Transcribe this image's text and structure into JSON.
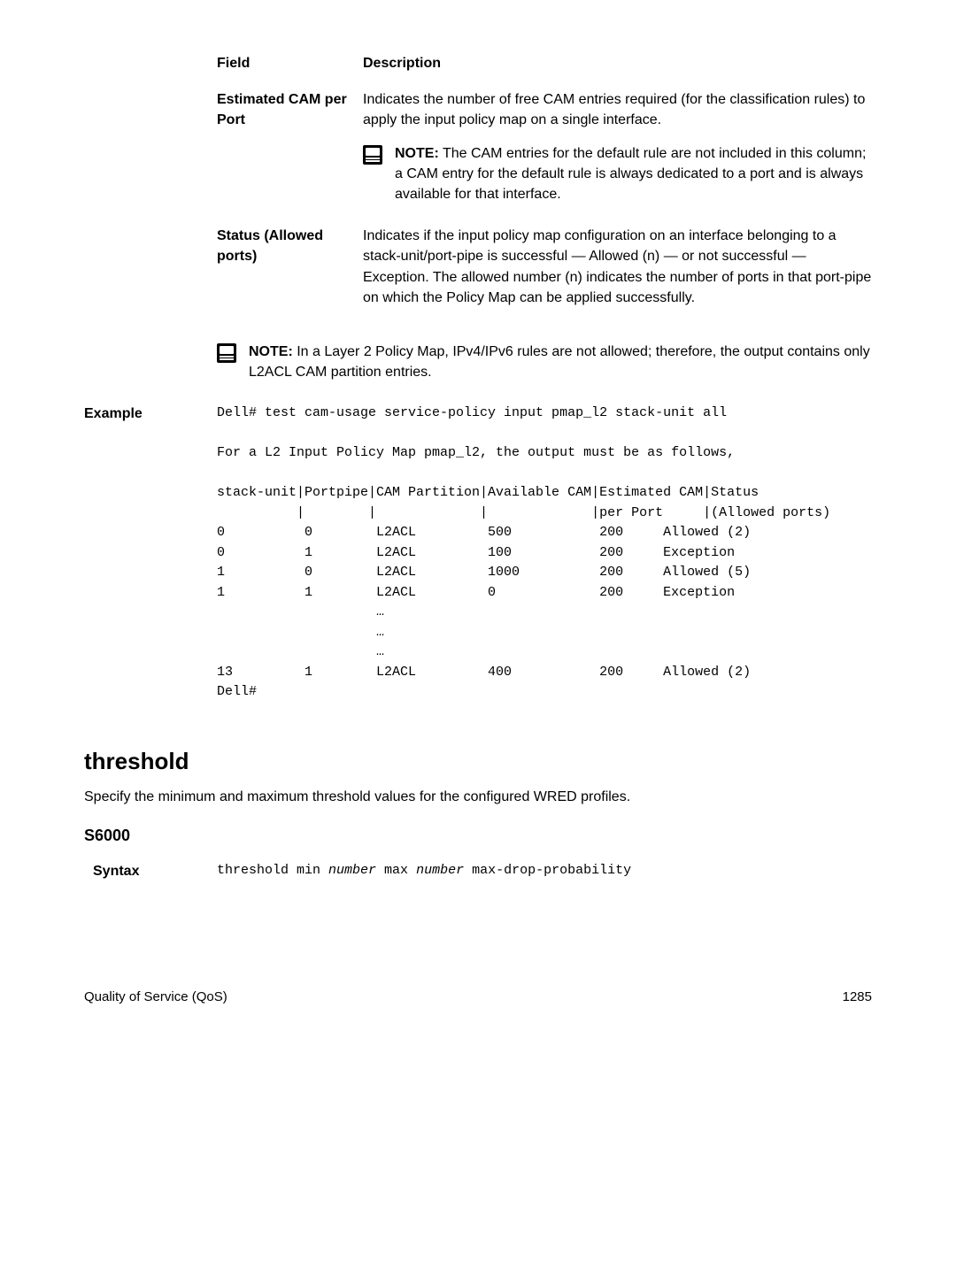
{
  "fields": {
    "header_field": "Field",
    "header_desc": "Description",
    "estimated_cam": {
      "label": "Estimated CAM per Port",
      "desc": "Indicates the number of free CAM entries required (for the classification rules) to apply the input policy map on a single interface.",
      "note_prefix": "NOTE:",
      "note_body": " The CAM entries for the default rule are not included in this column; a CAM entry for the default rule is always dedicated to a port and is always available for that interface."
    },
    "status_allowed": {
      "label": "Status (Allowed ports)",
      "desc": "Indicates if the input policy map configuration on an interface belonging to a stack-unit/port-pipe is successful — Allowed (n) — or not successful — Exception. The allowed number (n) indicates the number of ports in that port-pipe on which the Policy Map can be applied successfully."
    }
  },
  "standalone_note": {
    "prefix": "NOTE:",
    "body": " In a Layer 2 Policy Map, IPv4/IPv6 rules are not allowed; therefore, the output contains only L2ACL CAM partition entries."
  },
  "example": {
    "label": "Example",
    "code": "Dell# test cam-usage service-policy input pmap_l2 stack-unit all\n\nFor a L2 Input Policy Map pmap_l2, the output must be as follows,\n\nstack-unit|Portpipe|CAM Partition|Available CAM|Estimated CAM|Status\n          |        |             |             |per Port     |(Allowed ports)\n0          0        L2ACL         500           200     Allowed (2)\n0          1        L2ACL         100           200     Exception\n1          0        L2ACL         1000          200     Allowed (5)\n1          1        L2ACL         0             200     Exception\n                    …\n                    …\n                    …\n13         1        L2ACL         400           200     Allowed (2)\nDell#"
  },
  "threshold": {
    "heading": "threshold",
    "desc": "Specify the minimum and maximum threshold values for the configured WRED profiles.",
    "subhead": "S6000",
    "syntax_label": "Syntax",
    "syntax_pre": "threshold min ",
    "syntax_num1": "number",
    "syntax_mid": " max ",
    "syntax_num2": "number",
    "syntax_post": " max-drop-probability"
  },
  "footer": {
    "left": "Quality of Service (QoS)",
    "right": "1285"
  }
}
